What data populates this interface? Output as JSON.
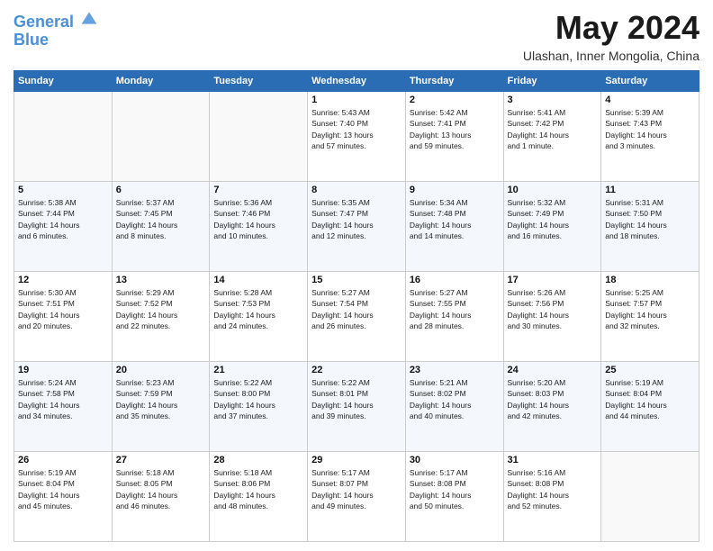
{
  "header": {
    "logo_line1": "General",
    "logo_line2": "Blue",
    "month_title": "May 2024",
    "location": "Ulashan, Inner Mongolia, China"
  },
  "days_of_week": [
    "Sunday",
    "Monday",
    "Tuesday",
    "Wednesday",
    "Thursday",
    "Friday",
    "Saturday"
  ],
  "weeks": [
    [
      {
        "day": "",
        "info": ""
      },
      {
        "day": "",
        "info": ""
      },
      {
        "day": "",
        "info": ""
      },
      {
        "day": "1",
        "info": "Sunrise: 5:43 AM\nSunset: 7:40 PM\nDaylight: 13 hours\nand 57 minutes."
      },
      {
        "day": "2",
        "info": "Sunrise: 5:42 AM\nSunset: 7:41 PM\nDaylight: 13 hours\nand 59 minutes."
      },
      {
        "day": "3",
        "info": "Sunrise: 5:41 AM\nSunset: 7:42 PM\nDaylight: 14 hours\nand 1 minute."
      },
      {
        "day": "4",
        "info": "Sunrise: 5:39 AM\nSunset: 7:43 PM\nDaylight: 14 hours\nand 3 minutes."
      }
    ],
    [
      {
        "day": "5",
        "info": "Sunrise: 5:38 AM\nSunset: 7:44 PM\nDaylight: 14 hours\nand 6 minutes."
      },
      {
        "day": "6",
        "info": "Sunrise: 5:37 AM\nSunset: 7:45 PM\nDaylight: 14 hours\nand 8 minutes."
      },
      {
        "day": "7",
        "info": "Sunrise: 5:36 AM\nSunset: 7:46 PM\nDaylight: 14 hours\nand 10 minutes."
      },
      {
        "day": "8",
        "info": "Sunrise: 5:35 AM\nSunset: 7:47 PM\nDaylight: 14 hours\nand 12 minutes."
      },
      {
        "day": "9",
        "info": "Sunrise: 5:34 AM\nSunset: 7:48 PM\nDaylight: 14 hours\nand 14 minutes."
      },
      {
        "day": "10",
        "info": "Sunrise: 5:32 AM\nSunset: 7:49 PM\nDaylight: 14 hours\nand 16 minutes."
      },
      {
        "day": "11",
        "info": "Sunrise: 5:31 AM\nSunset: 7:50 PM\nDaylight: 14 hours\nand 18 minutes."
      }
    ],
    [
      {
        "day": "12",
        "info": "Sunrise: 5:30 AM\nSunset: 7:51 PM\nDaylight: 14 hours\nand 20 minutes."
      },
      {
        "day": "13",
        "info": "Sunrise: 5:29 AM\nSunset: 7:52 PM\nDaylight: 14 hours\nand 22 minutes."
      },
      {
        "day": "14",
        "info": "Sunrise: 5:28 AM\nSunset: 7:53 PM\nDaylight: 14 hours\nand 24 minutes."
      },
      {
        "day": "15",
        "info": "Sunrise: 5:27 AM\nSunset: 7:54 PM\nDaylight: 14 hours\nand 26 minutes."
      },
      {
        "day": "16",
        "info": "Sunrise: 5:27 AM\nSunset: 7:55 PM\nDaylight: 14 hours\nand 28 minutes."
      },
      {
        "day": "17",
        "info": "Sunrise: 5:26 AM\nSunset: 7:56 PM\nDaylight: 14 hours\nand 30 minutes."
      },
      {
        "day": "18",
        "info": "Sunrise: 5:25 AM\nSunset: 7:57 PM\nDaylight: 14 hours\nand 32 minutes."
      }
    ],
    [
      {
        "day": "19",
        "info": "Sunrise: 5:24 AM\nSunset: 7:58 PM\nDaylight: 14 hours\nand 34 minutes."
      },
      {
        "day": "20",
        "info": "Sunrise: 5:23 AM\nSunset: 7:59 PM\nDaylight: 14 hours\nand 35 minutes."
      },
      {
        "day": "21",
        "info": "Sunrise: 5:22 AM\nSunset: 8:00 PM\nDaylight: 14 hours\nand 37 minutes."
      },
      {
        "day": "22",
        "info": "Sunrise: 5:22 AM\nSunset: 8:01 PM\nDaylight: 14 hours\nand 39 minutes."
      },
      {
        "day": "23",
        "info": "Sunrise: 5:21 AM\nSunset: 8:02 PM\nDaylight: 14 hours\nand 40 minutes."
      },
      {
        "day": "24",
        "info": "Sunrise: 5:20 AM\nSunset: 8:03 PM\nDaylight: 14 hours\nand 42 minutes."
      },
      {
        "day": "25",
        "info": "Sunrise: 5:19 AM\nSunset: 8:04 PM\nDaylight: 14 hours\nand 44 minutes."
      }
    ],
    [
      {
        "day": "26",
        "info": "Sunrise: 5:19 AM\nSunset: 8:04 PM\nDaylight: 14 hours\nand 45 minutes."
      },
      {
        "day": "27",
        "info": "Sunrise: 5:18 AM\nSunset: 8:05 PM\nDaylight: 14 hours\nand 46 minutes."
      },
      {
        "day": "28",
        "info": "Sunrise: 5:18 AM\nSunset: 8:06 PM\nDaylight: 14 hours\nand 48 minutes."
      },
      {
        "day": "29",
        "info": "Sunrise: 5:17 AM\nSunset: 8:07 PM\nDaylight: 14 hours\nand 49 minutes."
      },
      {
        "day": "30",
        "info": "Sunrise: 5:17 AM\nSunset: 8:08 PM\nDaylight: 14 hours\nand 50 minutes."
      },
      {
        "day": "31",
        "info": "Sunrise: 5:16 AM\nSunset: 8:08 PM\nDaylight: 14 hours\nand 52 minutes."
      },
      {
        "day": "",
        "info": ""
      }
    ]
  ]
}
